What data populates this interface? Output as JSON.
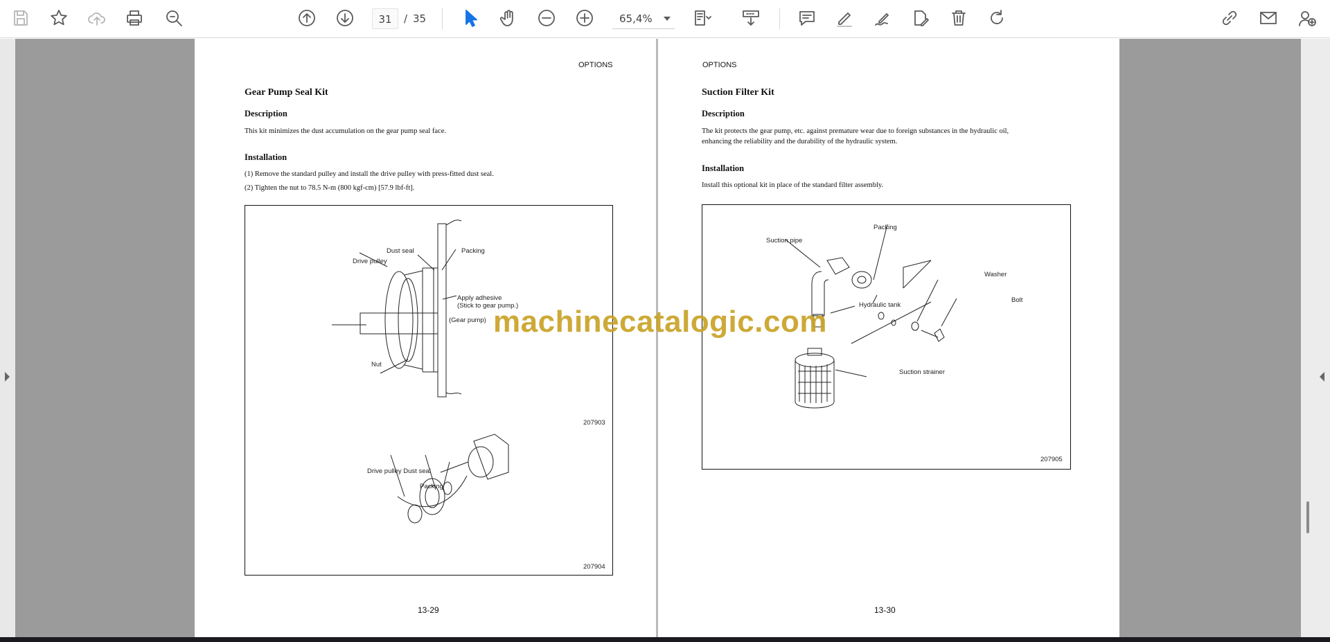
{
  "toolbar": {
    "current_page": "31",
    "page_separator": "/",
    "total_pages": "35",
    "zoom": "65,4%"
  },
  "left_page": {
    "header": "OPTIONS",
    "title": "Gear Pump Seal Kit",
    "description_heading": "Description",
    "description_text": "This kit minimizes the dust accumulation on the gear pump seal face.",
    "installation_heading": "Installation",
    "steps": [
      "(1)  Remove the standard pulley and install the drive pulley with press-fitted dust seal.",
      "(2)  Tighten the nut to 78.5 N-m (800 kgf-cm) [57.9 lbf-ft]."
    ],
    "figure": {
      "labels": {
        "dust_seal": "Dust seal",
        "packing": "Packing",
        "drive_pulley": "Drive pulley",
        "apply_adhesive": "Apply adhesive",
        "stick_to_pump": "(Stick to gear pump.)",
        "gear_pump": "(Gear pump)",
        "nut": "Nut",
        "drive_pulley_dust_seal": "Drive pulley Dust seal",
        "packing2": "Packing"
      },
      "fig_no_1": "207903",
      "fig_no_2": "207904"
    },
    "footer": "13-29"
  },
  "right_page": {
    "header": "OPTIONS",
    "title": "Suction Filter Kit",
    "description_heading": "Description",
    "description_lines": [
      "The kit protects the gear pump, etc. against premature wear due to foreign substances in the hydraulic oil,",
      "enhancing the reliability and the durability of the hydraulic system."
    ],
    "installation_heading": "Installation",
    "installation_text": "Install this optional kit in place of the standard filter assembly.",
    "figure": {
      "labels": {
        "packing": "Packing",
        "suction_pipe": "Suction pipe",
        "washer": "Washer",
        "bolt": "Bolt",
        "hydraulic_tank": "Hydraulic tank",
        "suction_strainer": "Suction strainer"
      },
      "fig_no": "207905"
    },
    "footer": "13-30"
  },
  "watermark": "machinecatalogic.com",
  "icons": [
    "save-icon",
    "bookmark-star-icon",
    "cloud-upload-icon",
    "print-icon",
    "zoom-search-icon",
    "page-up-icon",
    "page-down-icon",
    "select-cursor-icon",
    "hand-tool-icon",
    "zoom-out-icon",
    "zoom-in-icon",
    "page-layout-icon",
    "scroll-mode-icon",
    "comment-icon",
    "highlight-pen-icon",
    "draw-icon",
    "sign-icon",
    "delete-icon",
    "rotate-icon",
    "share-link-icon",
    "email-icon",
    "add-user-icon"
  ],
  "colors": {
    "accent": "#1473e6",
    "viewer_bg": "#9b9b9b",
    "watermark": "#c9a227"
  }
}
